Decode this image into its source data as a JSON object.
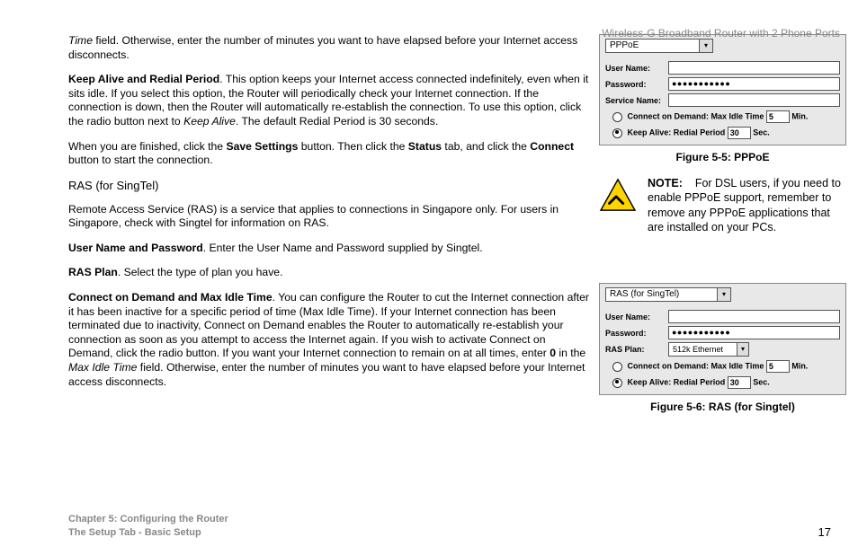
{
  "header": {
    "product": "Wireless-G Broadband Router with 2 Phone Ports"
  },
  "body": {
    "p1_a": "Time",
    "p1_b": " field. Otherwise, enter the number of minutes you want to have elapsed before your Internet access disconnects.",
    "p2_b": "Keep Alive and Redial Period",
    "p2_t": ". This option keeps your Internet access connected indefinitely, even when it sits idle. If you select this option, the Router will periodically check your Internet connection. If the connection is down, then the Router will automatically re-establish the connection. To use this option, click the radio button next to ",
    "p2_i": "Keep Alive",
    "p2_t2": ". The default Redial Period is 30 seconds.",
    "p3_a": "When you are finished, click the ",
    "p3_b1": "Save Settings",
    "p3_c": " button. Then click the ",
    "p3_b2": "Status",
    "p3_d": " tab, and click the ",
    "p3_b3": "Connect",
    "p3_e": " button to start the connection.",
    "h_ras": "RAS (for SingTel)",
    "p4": "Remote Access Service (RAS) is a service that applies to connections in Singapore only. For users in Singapore, check with Singtel for information on RAS.",
    "p5_b": "User Name and Password",
    "p5_t": ". Enter the User Name and Password supplied by Singtel.",
    "p6_b": "RAS Plan",
    "p6_t": ". Select the type of plan you have.",
    "p7_b": "Connect on Demand and Max Idle Time",
    "p7_t1": ". You can configure the Router to cut the Internet connection after it has been inactive for a specific period of time (Max Idle Time). If your Internet connection has been terminated due to inactivity, Connect on Demand enables the Router to automatically re-establish your connection as soon as you attempt to access the Internet again. If you wish to activate Connect on Demand, click the radio button. If you want your Internet connection to remain on at all times, enter ",
    "p7_b2": "0",
    "p7_t2": " in the ",
    "p7_i": "Max Idle Time",
    "p7_t3": " field. Otherwise, enter the number of minutes you want to have elapsed before your Internet access disconnects."
  },
  "fig55": {
    "dropdown": "PPPoE",
    "rows": {
      "user": "User Name:",
      "pass": "Password:",
      "serv": "Service Name:",
      "pass_value": "●●●●●●●●●●●"
    },
    "opt1_a": "Connect on Demand: Max Idle Time",
    "opt1_v": "5",
    "opt1_u": "Min.",
    "opt2_a": "Keep Alive: Redial Period",
    "opt2_v": "30",
    "opt2_u": "Sec.",
    "caption": "Figure 5-5: PPPoE"
  },
  "note": {
    "label": "NOTE:",
    "text": "For DSL users, if you need to enable PPPoE support, remember to remove any PPPoE applications that are installed on your PCs."
  },
  "fig56": {
    "dropdown": "RAS (for SingTel)",
    "rows": {
      "user": "User Name:",
      "pass": "Password:",
      "plan": "RAS Plan:",
      "pass_value": "●●●●●●●●●●●",
      "plan_value": "512k Ethernet"
    },
    "opt1_a": "Connect on Demand: Max Idle Time",
    "opt1_v": "5",
    "opt1_u": "Min.",
    "opt2_a": "Keep Alive: Redial Period",
    "opt2_v": "30",
    "opt2_u": "Sec.",
    "caption": "Figure 5-6: RAS (for Singtel)"
  },
  "footer": {
    "chapter": "Chapter 5: Configuring the Router",
    "subtitle": "The Setup Tab - Basic Setup",
    "page": "17"
  }
}
